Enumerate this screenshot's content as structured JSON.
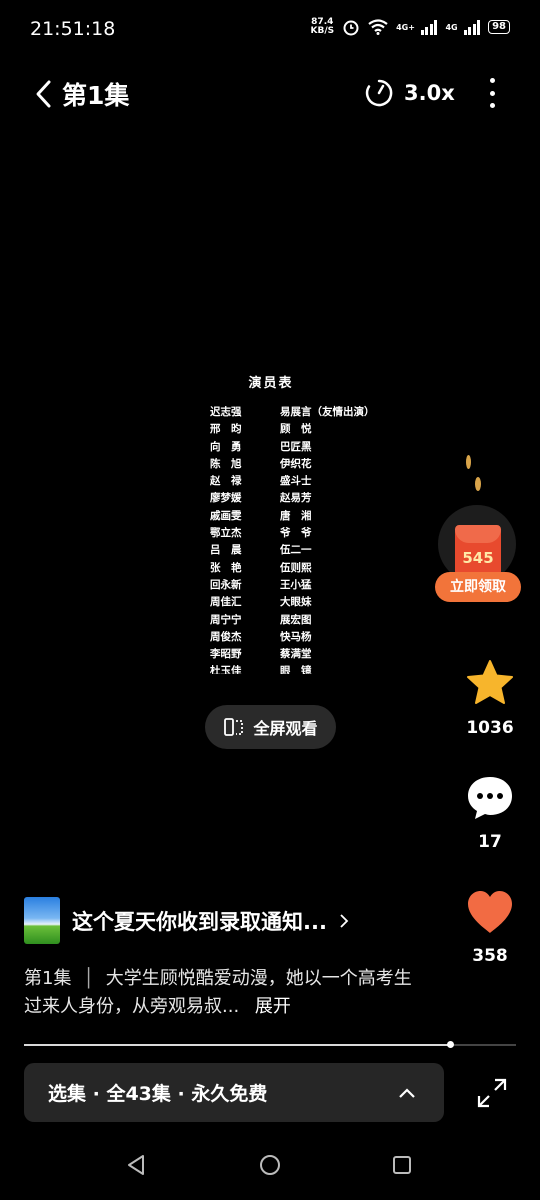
{
  "status_bar": {
    "time": "21:51:18",
    "net_speed_value": "87.4",
    "net_speed_unit": "KB/S",
    "net_type_1": "4G+",
    "net_type_2": "4G",
    "battery": "98"
  },
  "header": {
    "episode_title": "第1集",
    "playback_speed": "3.0x"
  },
  "credits": {
    "title": "演员表",
    "rows": [
      {
        "left": "迟志强",
        "right": "易展言（友情出演）"
      },
      {
        "left": "邢　昀",
        "right": "顾　悦"
      },
      {
        "left": "向　勇",
        "right": "巴匠黑"
      },
      {
        "left": "陈　旭",
        "right": "伊织花"
      },
      {
        "left": "赵　禄",
        "right": "盛斗士"
      },
      {
        "left": "廖梦媛",
        "right": "赵易芳"
      },
      {
        "left": "戚画雯",
        "right": "唐　湘"
      },
      {
        "left": "鄂立杰",
        "right": "爷　爷"
      },
      {
        "left": "吕　晨",
        "right": "伍二一"
      },
      {
        "left": "张　艳",
        "right": "伍则熙"
      },
      {
        "left": "回永新",
        "right": "王小猛"
      },
      {
        "left": "周佳汇",
        "right": "大眼妹"
      },
      {
        "left": "周宁宁",
        "right": "展宏图"
      },
      {
        "left": "周俊杰",
        "right": "快马杨"
      },
      {
        "left": "李昭野",
        "right": "蔡满堂"
      },
      {
        "left": "杜玉佳",
        "right": "眼　镜"
      }
    ]
  },
  "fullscreen_button": {
    "label": "全屏观看"
  },
  "red_packet": {
    "amount": "545",
    "label": "立即领取"
  },
  "rail": {
    "favorites": {
      "count": "1036",
      "icon": "star-icon",
      "color": "#f7b52c"
    },
    "comments": {
      "count": "17",
      "icon": "comment-icon"
    },
    "likes": {
      "count": "358",
      "icon": "heart-icon",
      "color": "#f26b43"
    }
  },
  "info": {
    "show_title": "这个夏天你收到录取通知...",
    "episode_prefix": "第1集",
    "description": "大学生顾悦酷爱动漫，她以一个高考生过来人身份，从旁观易叔...",
    "expand_label": "展开"
  },
  "progress": {
    "fraction": 0.866
  },
  "episode_bar": {
    "label": "选集 · 全43集 · 永久免费"
  }
}
